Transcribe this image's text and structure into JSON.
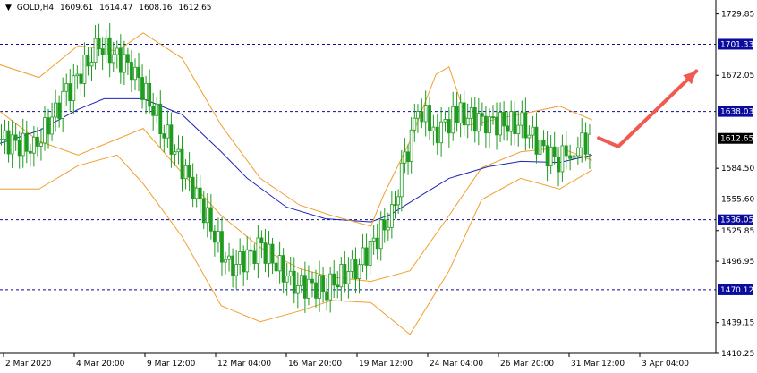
{
  "header": {
    "symbol_timeframe": "GOLD,H4",
    "open": "1609.61",
    "high": "1614.47",
    "low": "1608.16",
    "close": "1612.65"
  },
  "colors": {
    "candle": "#1f9b1f",
    "bollinger": "#f0a030",
    "moving_average": "#1e24b4",
    "level_line": "#0b0b9e",
    "level_label_bg": "#0b0b9e",
    "current_price_bg": "#000000",
    "arrow": "#f05a50",
    "axis": "#000000"
  },
  "chart_data": {
    "type": "line",
    "price_axis": {
      "ylim": [
        1410.25,
        1743.0
      ],
      "ticks": [
        "1729.85",
        "1672.05",
        "1584.50",
        "1555.60",
        "1525.85",
        "1496.95",
        "1439.15",
        "1410.25"
      ]
    },
    "time_axis": {
      "labels": [
        "2 Mar 2020",
        "4 Mar 20:00",
        "9 Mar 12:00",
        "12 Mar 04:00",
        "16 Mar 20:00",
        "19 Mar 12:00",
        "24 Mar 04:00",
        "26 Mar 20:00",
        "31 Mar 12:00",
        "3 Apr 04:00"
      ]
    },
    "levels": [
      {
        "value": 1701.33,
        "label": "1701.33"
      },
      {
        "value": 1638.03,
        "label": "1638.03"
      },
      {
        "value": 1536.05,
        "label": "1536.05"
      },
      {
        "value": 1470.12,
        "label": "1470.12"
      }
    ],
    "current_price": {
      "value": 1612.65,
      "label": "1612.65"
    },
    "series": [
      {
        "x": [
          0,
          6,
          12,
          18,
          22,
          28,
          34,
          40,
          46,
          51,
          57,
          63,
          69,
          74,
          80,
          86,
          91
        ],
        "values": [
          1638,
          1610,
          1597,
          1612,
          1622,
          1580,
          1540,
          1510,
          1490,
          1482,
          1478,
          1488,
          1540,
          1585,
          1600,
          1604,
          1592
        ]
      },
      {
        "x": [
          0,
          6,
          12,
          16,
          22,
          28,
          34,
          38,
          44,
          50,
          57,
          60,
          65,
          69,
          75,
          80,
          86,
          91
        ],
        "values": [
          1608,
          1620,
          1640,
          1650,
          1650,
          1635,
          1600,
          1575,
          1548,
          1537,
          1534,
          1541,
          1560,
          1575,
          1586,
          1591,
          1590,
          1597
        ]
      },
      {
        "x": [
          0,
          6,
          12,
          18,
          22,
          28,
          34,
          40,
          46,
          51,
          57,
          59,
          63,
          67,
          69,
          72,
          78,
          86,
          91
        ],
        "values": [
          1682,
          1670,
          1700,
          1695,
          1712,
          1688,
          1625,
          1575,
          1550,
          1540,
          1530,
          1560,
          1610,
          1673,
          1680,
          1625,
          1633,
          1643,
          1630
        ]
      },
      {
        "x": [
          0,
          6,
          12,
          18,
          22,
          28,
          34,
          40,
          46,
          51,
          57,
          63,
          69,
          74,
          80,
          86,
          91
        ],
        "values": [
          1565,
          1565,
          1587,
          1597,
          1570,
          1520,
          1455,
          1440,
          1450,
          1460,
          1458,
          1428,
          1488,
          1555,
          1575,
          1565,
          1583
        ]
      }
    ],
    "candles": {
      "x": [
        0,
        5,
        10,
        15,
        20,
        25,
        30,
        35,
        40,
        45,
        50,
        55,
        60,
        62,
        64,
        67,
        70,
        75,
        80,
        85,
        88,
        91
      ],
      "values": [
        1612,
        1603,
        1655,
        1700,
        1680,
        1620,
        1560,
        1490,
        1510,
        1475,
        1472,
        1495,
        1540,
        1590,
        1640,
        1620,
        1635,
        1628,
        1625,
        1590,
        1604,
        1613
      ]
    },
    "arrow": {
      "x": [
        92,
        95,
        107
      ],
      "values": [
        1613,
        1605,
        1676
      ]
    }
  }
}
